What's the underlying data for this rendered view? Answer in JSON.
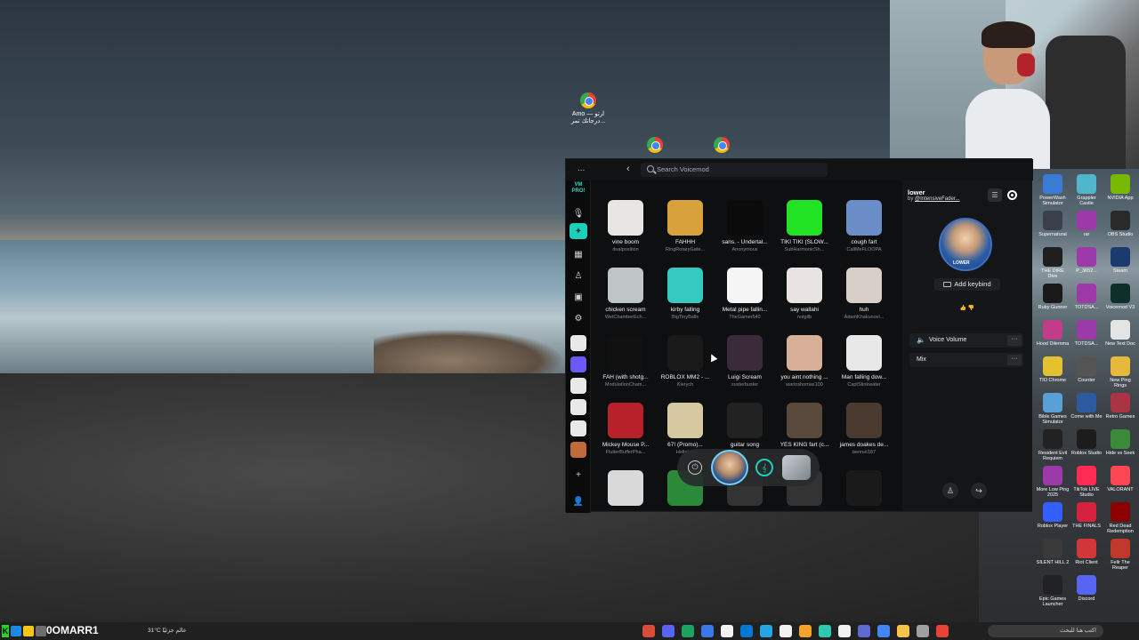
{
  "desktop": {
    "shortcut_label": "Amo — ارتو\nدرجاتك تمر...",
    "right_icons": [
      {
        "label": "PowerWash Simulator",
        "color": "#3a7bd5"
      },
      {
        "label": "Grappler Castle",
        "color": "#4fb7c9"
      },
      {
        "label": "NVIDIA App",
        "color": "#76b900"
      },
      {
        "label": "Supernatural",
        "color": "#3a3f4a"
      },
      {
        "label": "rar",
        "color": "#9b3aa8"
      },
      {
        "label": "OBS Studio",
        "color": "#2a2a2a"
      },
      {
        "label": "THE DIRE Dive",
        "color": "#1e1e1e"
      },
      {
        "label": "P_3652...",
        "color": "#9b3aa8"
      },
      {
        "label": "Steam",
        "color": "#1b3b6f"
      },
      {
        "label": "Ruby Gunner",
        "color": "#1a1a1a"
      },
      {
        "label": "TOTDSA...",
        "color": "#9b3aa8"
      },
      {
        "label": "Voicemod V3",
        "color": "#0f2f2a"
      },
      {
        "label": "Hood Dilemma",
        "color": "#c23c8a"
      },
      {
        "label": "TOTDSA...",
        "color": "#9b3aa8"
      },
      {
        "label": "New Text Doc",
        "color": "#e4e4e4"
      },
      {
        "label": "TIO Chrome",
        "color": "#e4c12f"
      },
      {
        "label": "Counter",
        "color": "#555555"
      },
      {
        "label": "New Ping Rings",
        "color": "#e6b93a"
      },
      {
        "label": "Bible Games Simulator",
        "color": "#5aa0d8"
      },
      {
        "label": "Come with Me",
        "color": "#2c5aa0"
      },
      {
        "label": "Retro Games",
        "color": "#aa3344"
      },
      {
        "label": "Resident Evil Requiem",
        "color": "#222222"
      },
      {
        "label": "Roblox Studio",
        "color": "#1c1c1c"
      },
      {
        "label": "Hide vs Seek",
        "color": "#3a8a3a"
      },
      {
        "label": "More Low Ping 2025",
        "color": "#9b3aa8"
      },
      {
        "label": "TikTok LIVE Studio",
        "color": "#fe2c55"
      },
      {
        "label": "VALORANT",
        "color": "#ff4655"
      },
      {
        "label": "Roblox Player",
        "color": "#335fff"
      },
      {
        "label": "THE FINALS",
        "color": "#d4213d"
      },
      {
        "label": "Red Dead Redemption",
        "color": "#8b0000"
      },
      {
        "label": "SILENT HILL 2",
        "color": "#3a3a3a"
      },
      {
        "label": "Riot Client",
        "color": "#d13639"
      },
      {
        "label": "Fellr The Reaper",
        "color": "#c0392b"
      },
      {
        "label": "Epic Games Launcher",
        "color": "#222222"
      },
      {
        "label": "Discord",
        "color": "#5865f2"
      }
    ]
  },
  "voicemod": {
    "menu_label": "...",
    "back_label": "‹",
    "search_placeholder": "Search Voicemod",
    "logo_text": "VM PRO!",
    "sidebar_icons": [
      "microphone-icon",
      "soundboard-icon",
      "apps-icon",
      "bug-icon",
      "store-icon",
      "settings-icon"
    ],
    "sounds": [
      {
        "name": "vine boom",
        "author": "dualposition",
        "color": "#e8e6e2"
      },
      {
        "name": "FAHHH",
        "author": "RingRotaryGate...",
        "color": "#d9a13b"
      },
      {
        "name": "sans. - Undertal...",
        "author": "Anonymous",
        "color": "#0b0b0b"
      },
      {
        "name": "TIKI TIKI (SLOW...",
        "author": "SubHarmonicSh...",
        "color": "#22e224"
      },
      {
        "name": "cough fart",
        "author": "CallMeFLOOPA",
        "color": "#6a8cc7"
      },
      {
        "name": "chicken scream",
        "author": "WetChamberEch...",
        "color": "#bfc4c6"
      },
      {
        "name": "kirby falling",
        "author": "BigTinyBalls",
        "color": "#36c9c2"
      },
      {
        "name": "Metal pipe fallin...",
        "author": "TheGamer540",
        "color": "#f5f5f5"
      },
      {
        "name": "say wallahi",
        "author": "notgilb",
        "color": "#e9e4e2"
      },
      {
        "name": "huh",
        "author": "AdamKhakunovi...",
        "color": "#d8d0c8"
      },
      {
        "name": "FAH (with shotg...",
        "author": "ModulationCham...",
        "color": "#111111"
      },
      {
        "name": "ROBLOX MM2 - ...",
        "author": "Kierych",
        "color": "#1a1a1a"
      },
      {
        "name": "Luigi Scream",
        "author": "susterbuster",
        "color": "#3a2a3a"
      },
      {
        "name": "you aint nothing ...",
        "author": "warioshomas100",
        "color": "#d8b09a"
      },
      {
        "name": "Man falling dow...",
        "author": "CaptStinkwater",
        "color": "#e8e8e8"
      },
      {
        "name": "Mickey Mouse P...",
        "author": "FlutterBufferPha...",
        "color": "#b8202a"
      },
      {
        "name": "67! (Promo)...",
        "author": "Heltch...",
        "color": "#d6c9a2"
      },
      {
        "name": "guitar song",
        "author": "...",
        "color": "#222222"
      },
      {
        "name": "YES KING fart (c...",
        "author": "...",
        "color": "#5a4a3e"
      },
      {
        "name": "james doakes de...",
        "author": "bennet187",
        "color": "#4a3a30"
      },
      {
        "name": "",
        "author": "",
        "color": "#d9d9d9"
      },
      {
        "name": "",
        "author": "",
        "color": "#2a8a3a"
      },
      {
        "name": "",
        "author": "",
        "color": "#333333"
      },
      {
        "name": "",
        "author": "",
        "color": "#333333"
      },
      {
        "name": "",
        "author": "",
        "color": "#1a1a1a"
      }
    ],
    "panel": {
      "voice_title": "lower",
      "by_prefix": "by",
      "author": "@IntensiveFader...",
      "avatar_label": "LOWER",
      "add_keybind": "Add keybind",
      "votes": "👍 👎",
      "voice_volume": "Voice Volume",
      "mix": "Mix",
      "more": "···"
    }
  },
  "taskbar": {
    "user": "0OMARR1",
    "weather": "31°C عالم جزئيًا",
    "search_placeholder": "اكتب هنا للبحث",
    "apps": [
      "#d94c3a",
      "#5865f2",
      "#1aa361",
      "#3b78e7",
      "#f2f2f2",
      "#0078d4",
      "#26a5e4",
      "#f2f2f2",
      "#f1a32a",
      "#2fc9b0",
      "#f2f2f2",
      "#5e6ad2",
      "#4285f4",
      "#f5c54a",
      "#a0a0a0",
      "#e94235"
    ]
  }
}
